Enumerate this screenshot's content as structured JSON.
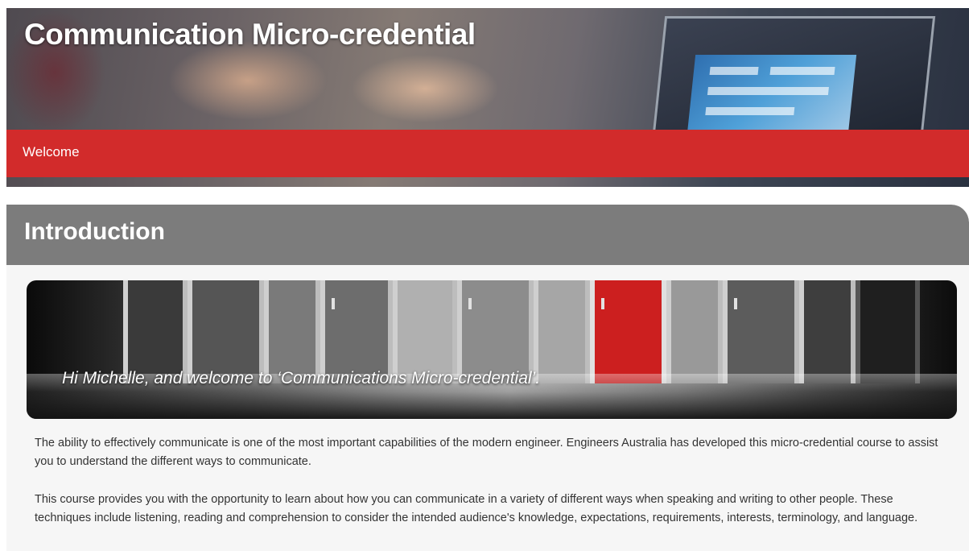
{
  "course": {
    "title": "Communication Micro-credential",
    "nav_label": "Welcome"
  },
  "section": {
    "heading": "Introduction",
    "hero_text": "Hi Michelle, and welcome to ‘Communications Micro-credential’.",
    "paragraphs": [
      "The ability to effectively communicate is one of the most important capabilities of the modern engineer. Engineers Australia has developed this micro-credential course to assist you to understand the different ways to communicate.",
      "This course provides you with the opportunity to learn about how you can communicate in a variety of different ways when speaking and writing to other people. These techniques include listening, reading and comprehension to consider the intended audience's knowledge, expectations, requirements, interests, terminology, and language."
    ]
  },
  "colors": {
    "accent_red": "#d22b2b",
    "header_grey": "#7c7c7c"
  }
}
